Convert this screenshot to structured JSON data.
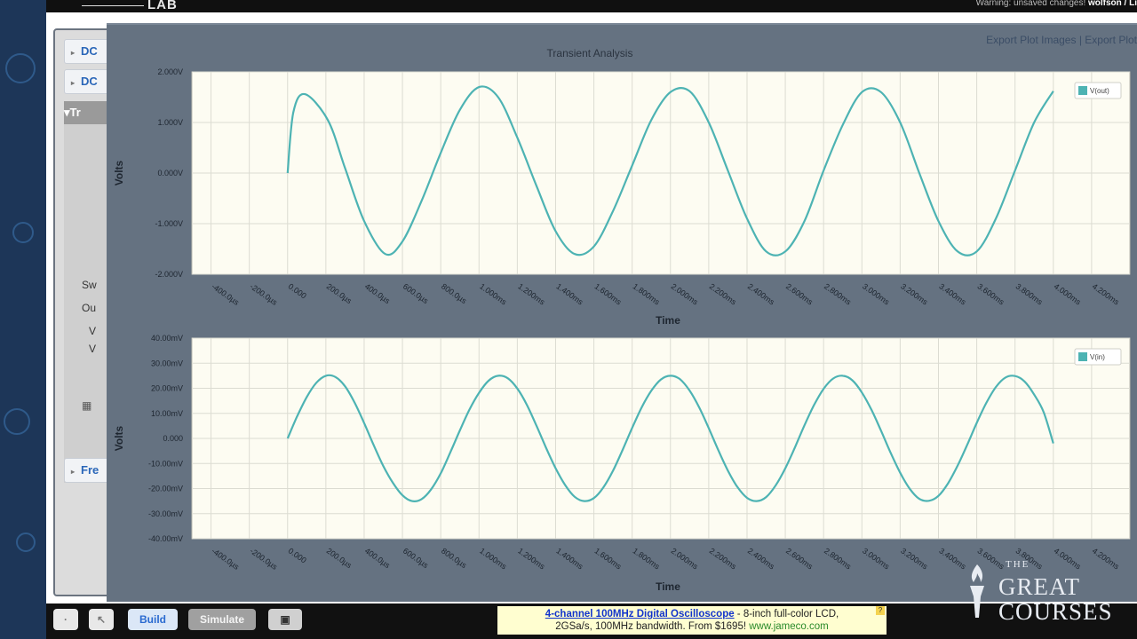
{
  "top_bar": {
    "logo_text": "LAB",
    "warning_prefix": "Warning: unsaved changes!",
    "user": "wolfson / Li"
  },
  "left_panel": {
    "items": [
      {
        "label": "DC"
      },
      {
        "label": "DC"
      },
      {
        "label": "Tr"
      },
      {
        "label": "Fre"
      }
    ],
    "rows": [
      "Sw",
      "Ou",
      "V",
      "V"
    ]
  },
  "export": {
    "link1": "Export Plot Images",
    "separator": "|",
    "link2": "Export Plot"
  },
  "colors": {
    "trace": "#4db3b3",
    "plot_bg": "#fdfcf2",
    "overlay": "#657281"
  },
  "chart_data": [
    {
      "type": "line",
      "title": "Transient Analysis",
      "xlabel": "Time",
      "ylabel": "Volts",
      "legend": "V(out)",
      "legend_position": "top-right",
      "grid": true,
      "xlim": [
        -0.0005,
        0.0044
      ],
      "ylim": [
        -2.0,
        2.0
      ],
      "y_ticks": [
        2.0,
        1.0,
        0.0,
        -1.0,
        -2.0
      ],
      "y_tick_labels": [
        "2.000V",
        "1.000V",
        "0.000V",
        "-1.000V",
        "-2.000V"
      ],
      "x_ticks": [
        -0.0004,
        -0.0002,
        0,
        0.0002,
        0.0004,
        0.0006,
        0.0008,
        0.001,
        0.0012,
        0.0014,
        0.0016,
        0.0018,
        0.002,
        0.0022,
        0.0024,
        0.0026,
        0.0028,
        0.003,
        0.0032,
        0.0034,
        0.0036,
        0.0038,
        0.004,
        0.0042
      ],
      "x_tick_labels": [
        "-400.0µs",
        "-200.0µs",
        "0.000",
        "200.0µs",
        "400.0µs",
        "600.0µs",
        "800.0µs",
        "1.000ms",
        "1.200ms",
        "1.400ms",
        "1.600ms",
        "1.800ms",
        "2.000ms",
        "2.200ms",
        "2.400ms",
        "2.600ms",
        "2.800ms",
        "3.000ms",
        "3.200ms",
        "3.400ms",
        "3.600ms",
        "3.800ms",
        "4.000ms",
        "4.200ms"
      ],
      "series": [
        {
          "name": "V(out)",
          "x": [
            0,
            3e-05,
            9e-05,
            0.00021,
            0.0003,
            0.0004,
            0.00051,
            0.0006,
            0.0007,
            0.0008,
            0.0009,
            0.001,
            0.0011,
            0.0012,
            0.0013,
            0.0014,
            0.0015,
            0.0016,
            0.0017,
            0.0018,
            0.0019,
            0.002,
            0.0021,
            0.0022,
            0.0023,
            0.0024,
            0.0025,
            0.0026,
            0.0027,
            0.0028,
            0.0029,
            0.003,
            0.0031,
            0.0032,
            0.0033,
            0.0034,
            0.0035,
            0.0036,
            0.0037,
            0.0038,
            0.0039,
            0.004
          ],
          "y": [
            0,
            1.2,
            1.56,
            1.05,
            0.1,
            -0.95,
            -1.6,
            -1.35,
            -0.55,
            0.4,
            1.25,
            1.7,
            1.5,
            0.7,
            -0.25,
            -1.15,
            -1.6,
            -1.45,
            -0.75,
            0.15,
            1.05,
            1.6,
            1.62,
            1.0,
            0.05,
            -0.9,
            -1.55,
            -1.55,
            -0.95,
            0.05,
            0.95,
            1.6,
            1.6,
            1.0,
            0.0,
            -0.95,
            -1.55,
            -1.55,
            -0.9,
            0.05,
            1.0,
            1.62
          ]
        }
      ]
    },
    {
      "type": "line",
      "title": "",
      "xlabel": "Time",
      "ylabel": "Volts",
      "legend": "V(in)",
      "legend_position": "top-right",
      "grid": true,
      "xlim": [
        -0.0005,
        0.0044
      ],
      "ylim": [
        -0.04,
        0.04
      ],
      "y_ticks": [
        0.04,
        0.03,
        0.02,
        0.01,
        0.0,
        -0.01,
        -0.02,
        -0.03,
        -0.04
      ],
      "y_tick_labels": [
        "40.00mV",
        "30.00mV",
        "20.00mV",
        "10.00mV",
        "0.000",
        "-10.00mV",
        "-20.00mV",
        "-30.00mV",
        "-40.00mV"
      ],
      "x_ticks": [
        -0.0004,
        -0.0002,
        0,
        0.0002,
        0.0004,
        0.0006,
        0.0008,
        0.001,
        0.0012,
        0.0014,
        0.0016,
        0.0018,
        0.002,
        0.0022,
        0.0024,
        0.0026,
        0.0028,
        0.003,
        0.0032,
        0.0034,
        0.0036,
        0.0038,
        0.004,
        0.0042
      ],
      "x_tick_labels": [
        "-400.0µs",
        "-200.0µs",
        "0.000",
        "200.0µs",
        "400.0µs",
        "600.0µs",
        "800.0µs",
        "1.000ms",
        "1.200ms",
        "1.400ms",
        "1.600ms",
        "1.800ms",
        "2.000ms",
        "2.200ms",
        "2.400ms",
        "2.600ms",
        "2.800ms",
        "3.000ms",
        "3.200ms",
        "3.400ms",
        "3.600ms",
        "3.800ms",
        "4.000ms",
        "4.200ms"
      ],
      "series": [
        {
          "name": "V(in)",
          "x": [
            0,
            5e-05,
            0.0001,
            0.00015,
            0.0002,
            0.00025,
            0.0003,
            0.00035,
            0.0004,
            0.00045,
            0.0005,
            0.00055,
            0.0006,
            0.00065,
            0.0007,
            0.00075,
            0.0008,
            0.00085,
            0.0009,
            0.00095,
            0.001,
            0.00105,
            0.0011,
            0.00115,
            0.0012,
            0.00125,
            0.0013,
            0.00135,
            0.0014,
            0.00145,
            0.0015,
            0.00155,
            0.0016,
            0.00165,
            0.0017,
            0.00175,
            0.0018,
            0.00185,
            0.0019,
            0.00195,
            0.002,
            0.00205,
            0.0021,
            0.00215,
            0.0022,
            0.00225,
            0.0023,
            0.00235,
            0.0024,
            0.00245,
            0.0025,
            0.00255,
            0.0026,
            0.00265,
            0.0027,
            0.00275,
            0.0028,
            0.00285,
            0.0029,
            0.00295,
            0.003,
            0.00305,
            0.0031,
            0.00315,
            0.0032,
            0.00325,
            0.0033,
            0.00335,
            0.0034,
            0.00345,
            0.0035,
            0.00355,
            0.0036,
            0.00365,
            0.0037,
            0.00375,
            0.0038,
            0.00385,
            0.0039,
            0.00395,
            0.004
          ],
          "y": [
            0,
            0.0088,
            0.0165,
            0.0222,
            0.025,
            0.0245,
            0.0208,
            0.0143,
            0.0061,
            -0.0027,
            -0.011,
            -0.0177,
            -0.0227,
            -0.025,
            -0.0242,
            -0.0203,
            -0.0139,
            -0.0056,
            0.0032,
            0.0115,
            0.0182,
            0.023,
            0.025,
            0.024,
            0.0199,
            0.0134,
            0.0051,
            -0.0037,
            -0.0119,
            -0.0186,
            -0.0233,
            -0.025,
            -0.0238,
            -0.0195,
            -0.0129,
            -0.0046,
            0.0042,
            0.0124,
            0.019,
            0.0235,
            0.025,
            0.0236,
            0.0191,
            0.0124,
            0.0041,
            -0.0047,
            -0.0128,
            -0.0194,
            -0.0237,
            -0.025,
            -0.0234,
            -0.0187,
            -0.0119,
            -0.0036,
            0.0052,
            0.0133,
            0.0198,
            0.0239,
            0.025,
            0.0232,
            0.0183,
            0.0114,
            0.0031,
            -0.0057,
            -0.0137,
            -0.0201,
            -0.0241,
            -0.0249,
            -0.0229,
            -0.0179,
            -0.0109,
            -0.0026,
            0.0062,
            0.0142,
            0.0205,
            0.0243,
            0.0249,
            0.0227,
            0.0175,
            0.0104,
            -0.002
          ]
        }
      ]
    }
  ],
  "bottom_bar": {
    "build_label": "Build",
    "simulate_label": "Simulate"
  },
  "ad": {
    "title": "4-channel 100MHz Digital Oscilloscope",
    "text1": " - 8-inch full-color LCD,",
    "text2": "2GSa/s, 100MHz bandwidth. From $1695!",
    "url": "www.jameco.com"
  },
  "watermark": {
    "the": "THE",
    "great": "GREAT",
    "courses": "COURSES"
  }
}
